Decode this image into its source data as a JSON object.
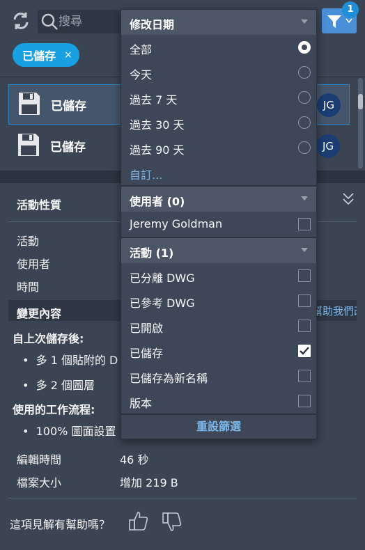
{
  "search": {
    "placeholder": "搜尋"
  },
  "filter": {
    "badge_count": "1"
  },
  "chip": {
    "label": "已儲存",
    "close": "×"
  },
  "versions": [
    {
      "label": "已儲存",
      "avatar": "JG",
      "selected": true
    },
    {
      "label": "已儲存",
      "avatar": "JG",
      "selected": false
    }
  ],
  "properties": {
    "title": "活動性質",
    "rows": [
      "活動",
      "使用者",
      "時間"
    ],
    "changes_title": "變更內容",
    "feedback_link": "幫助我們改善",
    "since_last_save": "自上次儲存後:",
    "bullet_1": "多 1 個貼附的 D",
    "bullet_2": "多 2 個圖層",
    "workflows_title": "使用的工作流程:",
    "bullet_3": "100% 圖面設置",
    "edit_time_label": "編輯時間",
    "edit_time_value": "46 秒",
    "file_size_label": "檔案大小",
    "file_size_value": "增加 219 B",
    "helpful_question": "這項見解有幫助嗎？"
  },
  "dropdown": {
    "date_header": "修改日期",
    "date_options": [
      {
        "label": "全部",
        "selected": true
      },
      {
        "label": "今天",
        "selected": false
      },
      {
        "label": "過去 7 天",
        "selected": false
      },
      {
        "label": "過去 30 天",
        "selected": false
      },
      {
        "label": "過去 90 天",
        "selected": false
      }
    ],
    "custom_link": "自訂...",
    "user_header": "使用者 (0)",
    "users": [
      {
        "label": "Jeremy Goldman",
        "checked": false
      }
    ],
    "activity_header": "活動 (1)",
    "activities": [
      {
        "label": "已分離 DWG",
        "checked": false
      },
      {
        "label": "已參考 DWG",
        "checked": false
      },
      {
        "label": "已開啟",
        "checked": false
      },
      {
        "label": "已儲存",
        "checked": true
      },
      {
        "label": "已儲存為新名稱",
        "checked": false
      },
      {
        "label": "版本",
        "checked": false
      }
    ],
    "reset_label": "重設篩選"
  },
  "colors": {
    "background": "#3b4453",
    "accent_blue": "#18a0e3",
    "link_blue": "#7cb7ea",
    "dropdown_bg": "#3e4757",
    "header_bg": "#4c5667"
  },
  "icons": [
    "refresh-icon",
    "search-icon",
    "filter-icon",
    "floppy-disk-icon",
    "chevron-double-down-icon",
    "thumbs-up-icon",
    "thumbs-down-icon"
  ]
}
